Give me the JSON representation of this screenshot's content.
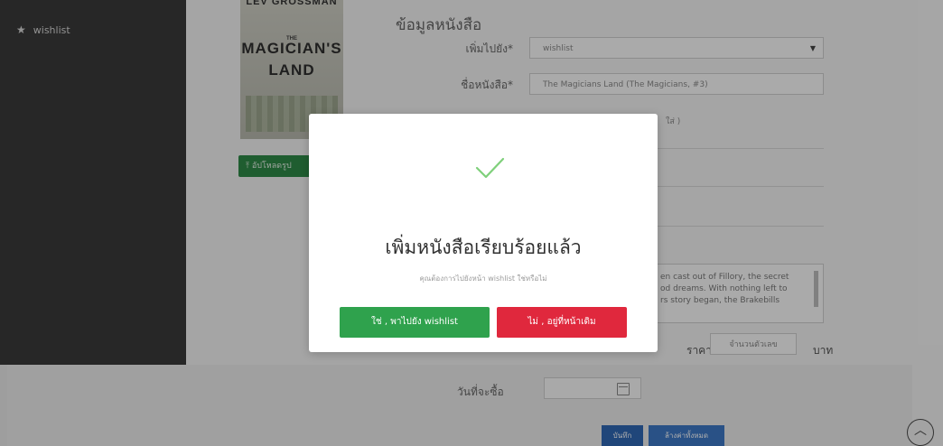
{
  "sidebar": {
    "items": [
      {
        "icon": "star-icon",
        "label": "wishlist"
      }
    ]
  },
  "book_cover": {
    "author_partial": "LEV GROSSMAN",
    "the": "THE",
    "title_line1": "MAGICIAN'S",
    "title_line2": "LAND"
  },
  "upload_button": {
    "label": "อัปโหลดรูป"
  },
  "form": {
    "section_title": "ข้อมูลหนังสือ",
    "add_to_label": "เพิ่มไปยัง*",
    "add_to_value": "wishlist",
    "book_name_label": "ชื่อหนังสือ*",
    "book_name_value": "The Magicians Land (The Magicians, #3)",
    "partial_field_suffix": "ใส่ )",
    "description_lines": [
      "en cast out of Fillory, the secret",
      "od dreams. With nothing left to",
      "rs story began, the Brakebills"
    ],
    "price_label": "ราคา",
    "price_placeholder": "จำนวนตัวเลข",
    "currency": "บาท",
    "purchase_date_label": "วันที่จะซื้อ",
    "save_button": "บันทึก",
    "clear_button": "ล้างค่าทั้งหมด"
  },
  "modal": {
    "title": "เพิ่มหนังสือเรียบร้อยแล้ว",
    "subtitle": "คุณต้องการไปยังหน้า wishlist ใช่หรือไม่",
    "confirm_button": "ใช่ , พาไปยัง wishlist",
    "cancel_button": "ไม่ , อยู่ที่หน้าเดิม"
  },
  "colors": {
    "confirm": "#2fa24d",
    "cancel": "#e0283d",
    "check": "#7fd07b"
  }
}
